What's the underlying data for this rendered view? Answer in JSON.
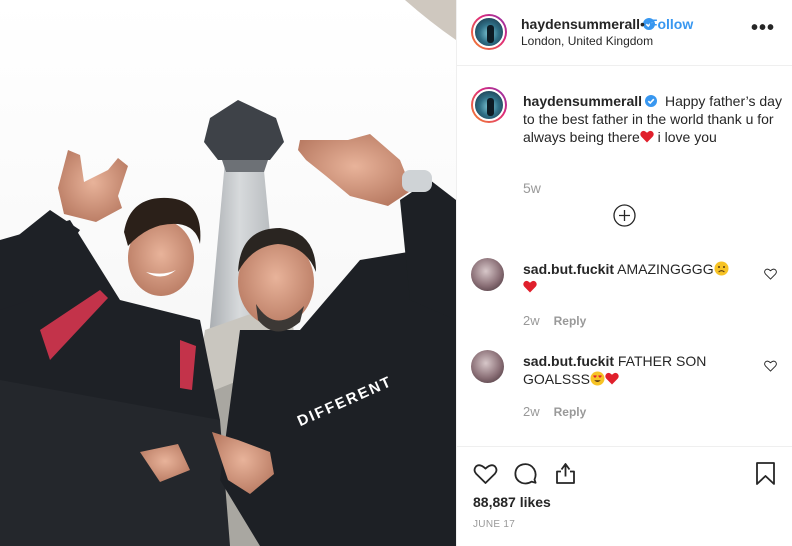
{
  "post": {
    "username": "haydensummerall",
    "follow_separator": "•",
    "follow_label": "Follow",
    "location": "London, United Kingdom",
    "more_label": "•••"
  },
  "caption": {
    "username": "haydensummerall",
    "text": "Happy father’s day to the best father in the world thank u for always being there",
    "text_after": " i love you",
    "time": "5w"
  },
  "comments": [
    {
      "username": "sad.but.fuckit",
      "text": "AMAZINGGGG",
      "time": "2w",
      "reply_label": "Reply"
    },
    {
      "username": "sad.but.fuckit",
      "text": "FATHER SON GOALSSS",
      "time": "2w",
      "reply_label": "Reply"
    }
  ],
  "footer": {
    "likes": "88,887 likes",
    "date": "JUNE 17"
  },
  "photo": {
    "hoodie_text": "DIFFERENT"
  },
  "colors": {
    "accent": "#3897f0",
    "text": "#262626",
    "muted": "#999999",
    "heart": "#ed4956"
  }
}
